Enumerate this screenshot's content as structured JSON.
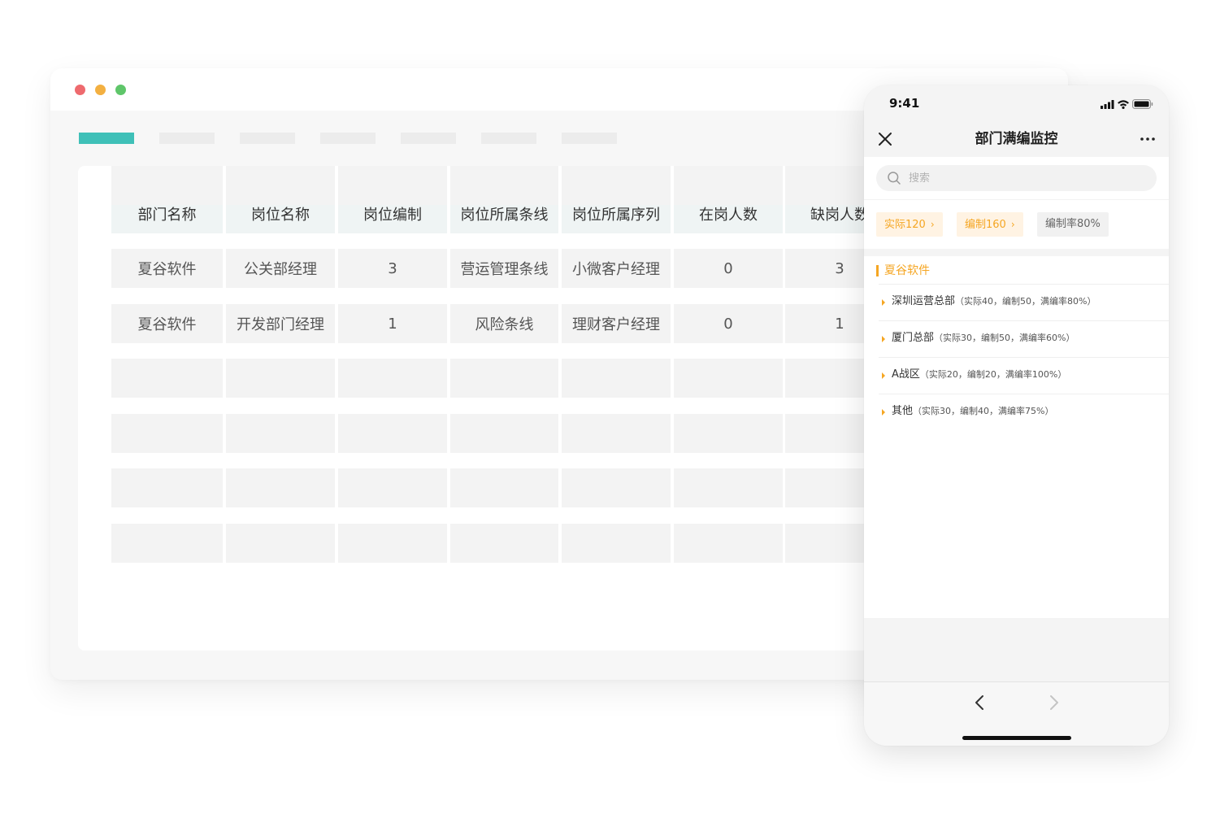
{
  "window": {
    "tabs": [
      {
        "label": "",
        "active": true
      },
      {
        "label": "",
        "active": false
      },
      {
        "label": "",
        "active": false
      },
      {
        "label": "",
        "active": false
      },
      {
        "label": "",
        "active": false
      },
      {
        "label": "",
        "active": false
      },
      {
        "label": "",
        "active": false
      }
    ],
    "table": {
      "headers": [
        "部门名称",
        "岗位名称",
        "岗位编制",
        "岗位所属条线",
        "岗位所属序列",
        "在岗人数",
        "缺岗人数"
      ],
      "rows": [
        [
          "夏谷软件",
          "公关部经理",
          "3",
          "营运管理条线",
          "小微客户经理",
          "0",
          "3"
        ],
        [
          "夏谷软件",
          "开发部门经理",
          "1",
          "风险条线",
          "理财客户经理",
          "0",
          "1"
        ],
        [
          "",
          "",
          "",
          "",
          "",
          "",
          ""
        ],
        [
          "",
          "",
          "",
          "",
          "",
          "",
          ""
        ],
        [
          "",
          "",
          "",
          "",
          "",
          "",
          ""
        ],
        [
          "",
          "",
          "",
          "",
          "",
          "",
          ""
        ],
        [
          "",
          "",
          "",
          "",
          "",
          "",
          ""
        ]
      ]
    }
  },
  "phone": {
    "status": {
      "time": "9:41",
      "icons": [
        "signal-icon",
        "wifi-icon",
        "battery-icon"
      ]
    },
    "nav": {
      "title": "部门满编监控",
      "left_icon": "close-icon",
      "right_icon": "more-icon"
    },
    "search": {
      "placeholder": "搜索",
      "value": ""
    },
    "chips": [
      {
        "label": "实际120",
        "arrow": "›",
        "style": "orange"
      },
      {
        "label": "编制160",
        "arrow": "›",
        "style": "orange"
      },
      {
        "label": "编制率80%",
        "arrow": "",
        "style": "gray"
      }
    ],
    "group": {
      "title": "夏谷软件",
      "items": [
        {
          "name": "深圳运营总部",
          "detail": "（实际40，编制50，满编率80%）"
        },
        {
          "name": "厦门总部",
          "detail": "（实际30，编制50，满编率60%）"
        },
        {
          "name": "A战区",
          "detail": "（实际20，编制20，满编率100%）"
        },
        {
          "name": "其他",
          "detail": "（实际30，编制40，满编率75%）"
        }
      ]
    },
    "bottom": {
      "back_icon": "chevron-left-icon",
      "forward_icon": "chevron-right-icon"
    },
    "colors": {
      "accent": "#f5a623",
      "teal": "#3fc0b8"
    }
  }
}
